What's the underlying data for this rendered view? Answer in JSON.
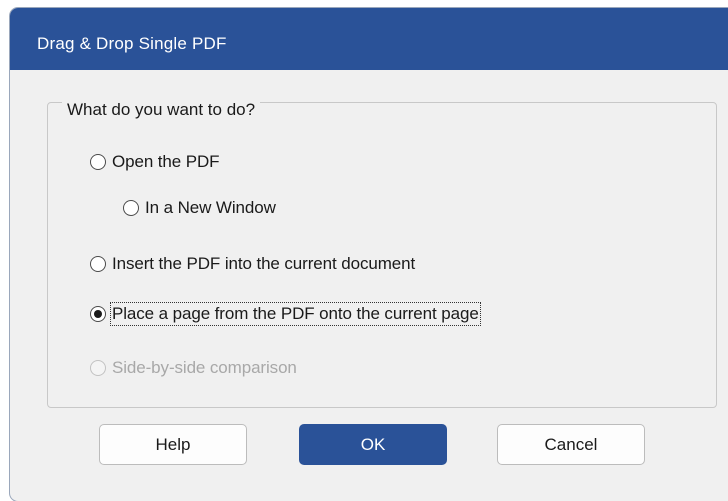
{
  "dialog": {
    "title": "Drag & Drop Single PDF"
  },
  "group": {
    "legend": "What do you want to do?",
    "options": [
      {
        "label": "Open the PDF",
        "selected": false,
        "enabled": true
      },
      {
        "label": "In a New Window",
        "selected": false,
        "enabled": true
      },
      {
        "label": "Insert the PDF into the current document",
        "selected": false,
        "enabled": true
      },
      {
        "label": "Place a page from the PDF onto the current page",
        "selected": true,
        "enabled": true
      },
      {
        "label": "Side-by-side comparison",
        "selected": false,
        "enabled": false
      }
    ]
  },
  "buttons": {
    "help": "Help",
    "ok": "OK",
    "cancel": "Cancel"
  },
  "colors": {
    "accent": "#2a5298",
    "dialog_background": "#f0f0f0",
    "disabled_text": "#a8a8a8"
  }
}
